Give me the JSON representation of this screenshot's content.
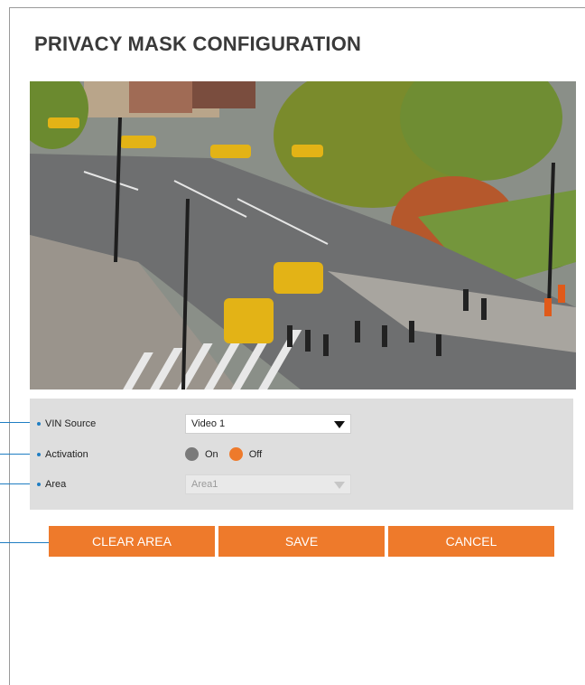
{
  "title": "PRIVACY MASK CONFIGURATION",
  "video": {
    "description_icon": "camera-feed-image"
  },
  "settings": {
    "vin_source": {
      "label": "VIN Source",
      "value": "Video 1"
    },
    "activation": {
      "label": "Activation",
      "options": [
        {
          "label": "On",
          "selected": false
        },
        {
          "label": "Off",
          "selected": true
        }
      ]
    },
    "area": {
      "label": "Area",
      "value": "Area1",
      "disabled": true
    }
  },
  "buttons": {
    "clear_area": "CLEAR AREA",
    "save": "SAVE",
    "cancel": "CANCEL"
  },
  "colors": {
    "accent": "#ee7a2b",
    "callout": "#1f7ec3",
    "panel": "#dedede"
  }
}
